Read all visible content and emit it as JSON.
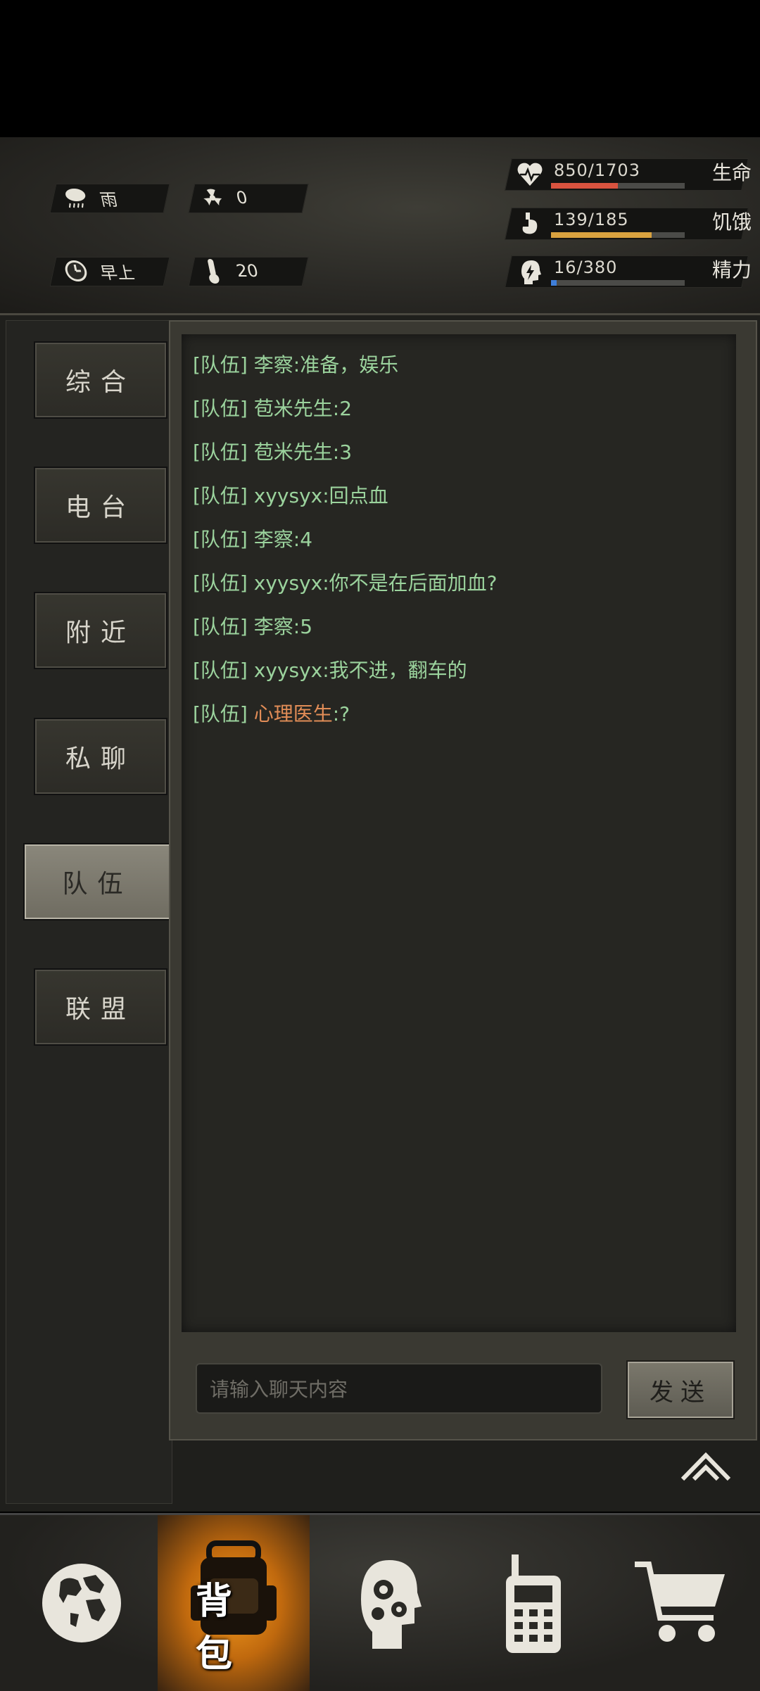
{
  "status": {
    "weather": "雨",
    "radiation": "0",
    "time_of_day": "早上",
    "temperature": "20",
    "health": {
      "value": "850/1703",
      "label": "生命",
      "fraction": 0.5,
      "color": "#d9533f"
    },
    "hunger": {
      "value": "139/185",
      "label": "饥饿",
      "fraction": 0.75,
      "color": "#d9a23f"
    },
    "energy": {
      "value": "16/380",
      "label": "精力",
      "fraction": 0.04,
      "color": "#3f7fd9"
    }
  },
  "sidebar": {
    "items": [
      {
        "label": "综合"
      },
      {
        "label": "电台"
      },
      {
        "label": "附近"
      },
      {
        "label": "私聊"
      },
      {
        "label": "队伍"
      },
      {
        "label": "联盟"
      }
    ],
    "active": "队伍"
  },
  "chat": {
    "messages": [
      {
        "tag": "[队伍]",
        "nick": "李察",
        "text": ":准备，娱乐"
      },
      {
        "tag": "[队伍]",
        "nick": "苞米先生",
        "text": ":2"
      },
      {
        "tag": "[队伍]",
        "nick": "苞米先生",
        "text": ":3"
      },
      {
        "tag": "[队伍]",
        "nick": "xyysyx",
        "text": ":回点血"
      },
      {
        "tag": "[队伍]",
        "nick": "李察",
        "text": ":4"
      },
      {
        "tag": "[队伍]",
        "nick": "xyysyx",
        "text": ":你不是在后面加血?"
      },
      {
        "tag": "[队伍]",
        "nick": "李察",
        "text": ":5"
      },
      {
        "tag": "[队伍]",
        "nick": "xyysyx",
        "text": ":我不进，翻车的"
      },
      {
        "tag": "[队伍]",
        "nick": "心理医生",
        "text": ":?"
      }
    ],
    "input_placeholder": "请输入聊天内容",
    "send_label": "发送"
  },
  "bottom_nav": {
    "items": [
      {
        "icon": "globe-icon"
      },
      {
        "icon": "backpack-icon",
        "label": "背包",
        "active": true
      },
      {
        "icon": "head-gears-icon"
      },
      {
        "icon": "radio-icon"
      },
      {
        "icon": "cart-icon"
      }
    ]
  }
}
